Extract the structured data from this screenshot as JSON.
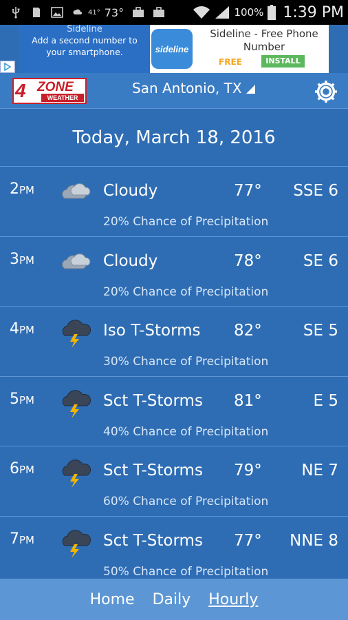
{
  "status_bar": {
    "temp_small": "41°",
    "temp": "73°",
    "battery": "100%",
    "time": "1:39 PM",
    "icons": [
      "usb-icon",
      "sd-card-icon",
      "image-icon",
      "weather-icon",
      "briefcase-icon",
      "briefcase-icon",
      "wifi-icon",
      "signal-icon",
      "battery-icon"
    ]
  },
  "ad": {
    "brand": "Sideline",
    "line1": "Add a second number to",
    "line2": "your smartphone.",
    "logo_text": "sideline",
    "title_line1": "Sideline - Free Phone",
    "title_line2": "Number",
    "free": "FREE",
    "install": "INSTALL"
  },
  "header": {
    "logo_number": "4",
    "logo_zone": "ZONE",
    "logo_weather": "WEATHER",
    "location": "San Antonio, TX"
  },
  "date": "Today, March 18, 2016",
  "hours": [
    {
      "hour": "2",
      "ampm": "PM",
      "icon": "cloudy",
      "condition": "Cloudy",
      "temp": "77°",
      "wind": "SSE 6",
      "precip": "20% Chance of Precipitation"
    },
    {
      "hour": "3",
      "ampm": "PM",
      "icon": "cloudy",
      "condition": "Cloudy",
      "temp": "78°",
      "wind": "SE 6",
      "precip": "20% Chance of Precipitation"
    },
    {
      "hour": "4",
      "ampm": "PM",
      "icon": "storm",
      "condition": "Iso T-Storms",
      "temp": "82°",
      "wind": "SE 5",
      "precip": "30% Chance of Precipitation"
    },
    {
      "hour": "5",
      "ampm": "PM",
      "icon": "storm",
      "condition": "Sct T-Storms",
      "temp": "81°",
      "wind": "E 5",
      "precip": "40% Chance of Precipitation"
    },
    {
      "hour": "6",
      "ampm": "PM",
      "icon": "storm",
      "condition": "Sct T-Storms",
      "temp": "79°",
      "wind": "NE 7",
      "precip": "60% Chance of Precipitation"
    },
    {
      "hour": "7",
      "ampm": "PM",
      "icon": "storm",
      "condition": "Sct T-Storms",
      "temp": "77°",
      "wind": "NNE 8",
      "precip": "50% Chance of Precipitation"
    }
  ],
  "nav": {
    "home": "Home",
    "daily": "Daily",
    "hourly": "Hourly",
    "active": "hourly"
  }
}
